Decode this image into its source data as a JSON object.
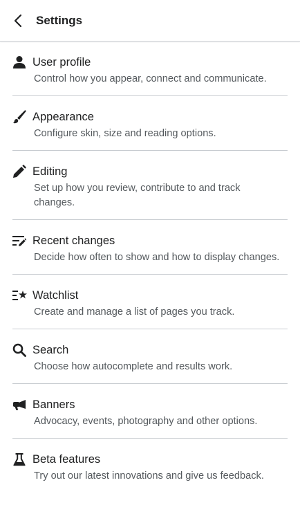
{
  "header": {
    "title": "Settings"
  },
  "settings": {
    "items": [
      {
        "icon": "user-icon",
        "title": "User profile",
        "description": "Control how you appear, connect and communicate."
      },
      {
        "icon": "brush-icon",
        "title": "Appearance",
        "description": "Configure skin, size and reading options."
      },
      {
        "icon": "pencil-icon",
        "title": "Editing",
        "description": "Set up how you review, contribute to and track changes."
      },
      {
        "icon": "recent-changes-icon",
        "title": "Recent changes",
        "description": "Decide how often to show and how to display changes."
      },
      {
        "icon": "watchlist-icon",
        "title": "Watchlist",
        "description": "Create and manage a list of pages you track."
      },
      {
        "icon": "search-icon",
        "title": "Search",
        "description": "Choose how autocomplete and results work."
      },
      {
        "icon": "megaphone-icon",
        "title": "Banners",
        "description": "Advocacy, events, photography and other options."
      },
      {
        "icon": "flask-icon",
        "title": "Beta features",
        "description": "Try out our latest innovations and give us feedback."
      }
    ]
  }
}
